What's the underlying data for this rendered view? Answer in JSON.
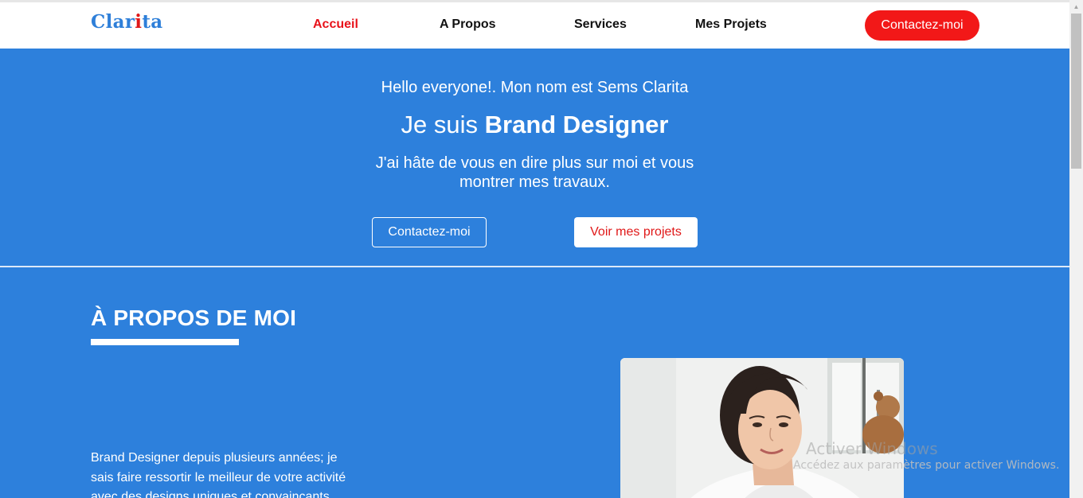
{
  "header": {
    "logo_prefix": "Clar",
    "logo_accent": "i",
    "logo_suffix": "ta",
    "nav": [
      {
        "label": "Accueil",
        "active": true
      },
      {
        "label": "A Propos",
        "active": false
      },
      {
        "label": "Services",
        "active": false
      },
      {
        "label": "Mes Projets",
        "active": false
      }
    ],
    "cta_label": "Contactez-moi"
  },
  "hero": {
    "hello": "Hello everyone!. Mon nom est Sems Clarita",
    "title_prefix": "Je suis",
    "title_bold": "Brand Designer",
    "desc_line1": "J'ai hâte de vous en dire plus sur moi et vous",
    "desc_line2": "montrer mes travaux.",
    "btn_contact": "Contactez-moi",
    "btn_projects": "Voir mes projets"
  },
  "about": {
    "title": "À PROPOS DE MOI",
    "text_line1": "Brand Designer depuis plusieurs années; je",
    "text_line2": "sais faire ressortir le meilleur de votre activité",
    "text_line3": "avec des designs uniques et convaincants."
  },
  "watermark": {
    "title": "Activer Windows",
    "subtitle": "Accédez aux paramètres pour activer Windows."
  },
  "colors": {
    "brand_blue": "#2d80dc",
    "accent_red": "#f21818"
  }
}
